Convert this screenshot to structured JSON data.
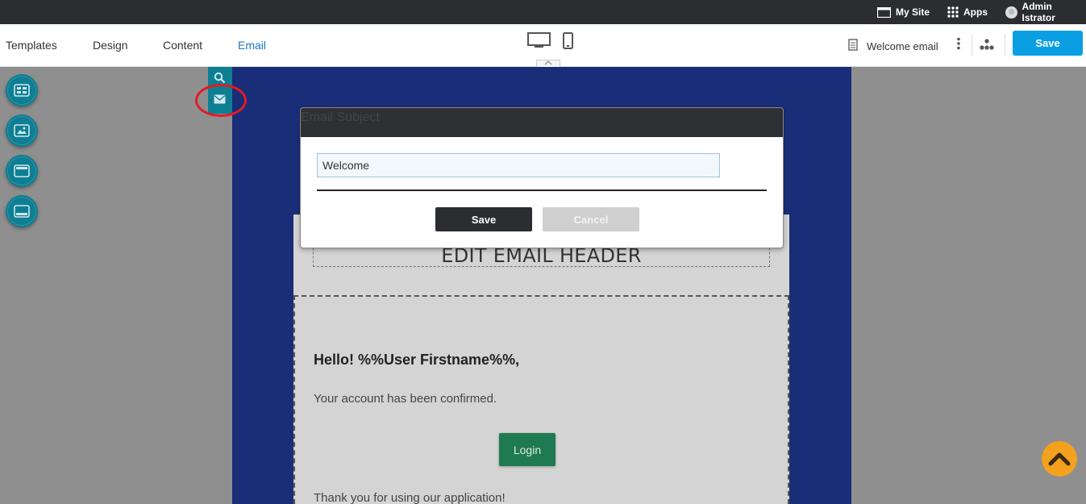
{
  "admin_bar": {
    "my_site": "My Site",
    "apps": "Apps",
    "user": "Admin Istrator"
  },
  "toolbar": {
    "nav": [
      "Templates",
      "Design",
      "Content",
      "Email"
    ],
    "active_nav": "Email",
    "document_label": "Welcome email",
    "save_label": "Save",
    "device_icons": [
      "desktop-icon",
      "mobile-icon"
    ]
  },
  "sidebar": {
    "buttons": [
      "layout-blocks-icon",
      "image-block-icon",
      "header-block-icon",
      "footer-block-icon"
    ]
  },
  "toolbox": {
    "icons": [
      "search-icon",
      "envelope-icon"
    ]
  },
  "email": {
    "header_text": "EDIT EMAIL HEADER",
    "greeting": "Hello! %%User Firstname%%,",
    "confirmed": "Your account has been confirmed.",
    "login_label": "Login",
    "thanks": "Thank you for using our application!"
  },
  "modal": {
    "title": "Email Subject",
    "input_value": "Welcome",
    "save_label": "Save",
    "cancel_label": "Cancel"
  },
  "colors": {
    "brand_blue": "#0a9fe3",
    "teal": "#0e7e93",
    "email_bg": "#1a2d78",
    "login_green": "#1f7a51",
    "scroll_orange": "#f4a11d",
    "highlight_red": "#e31b23"
  }
}
